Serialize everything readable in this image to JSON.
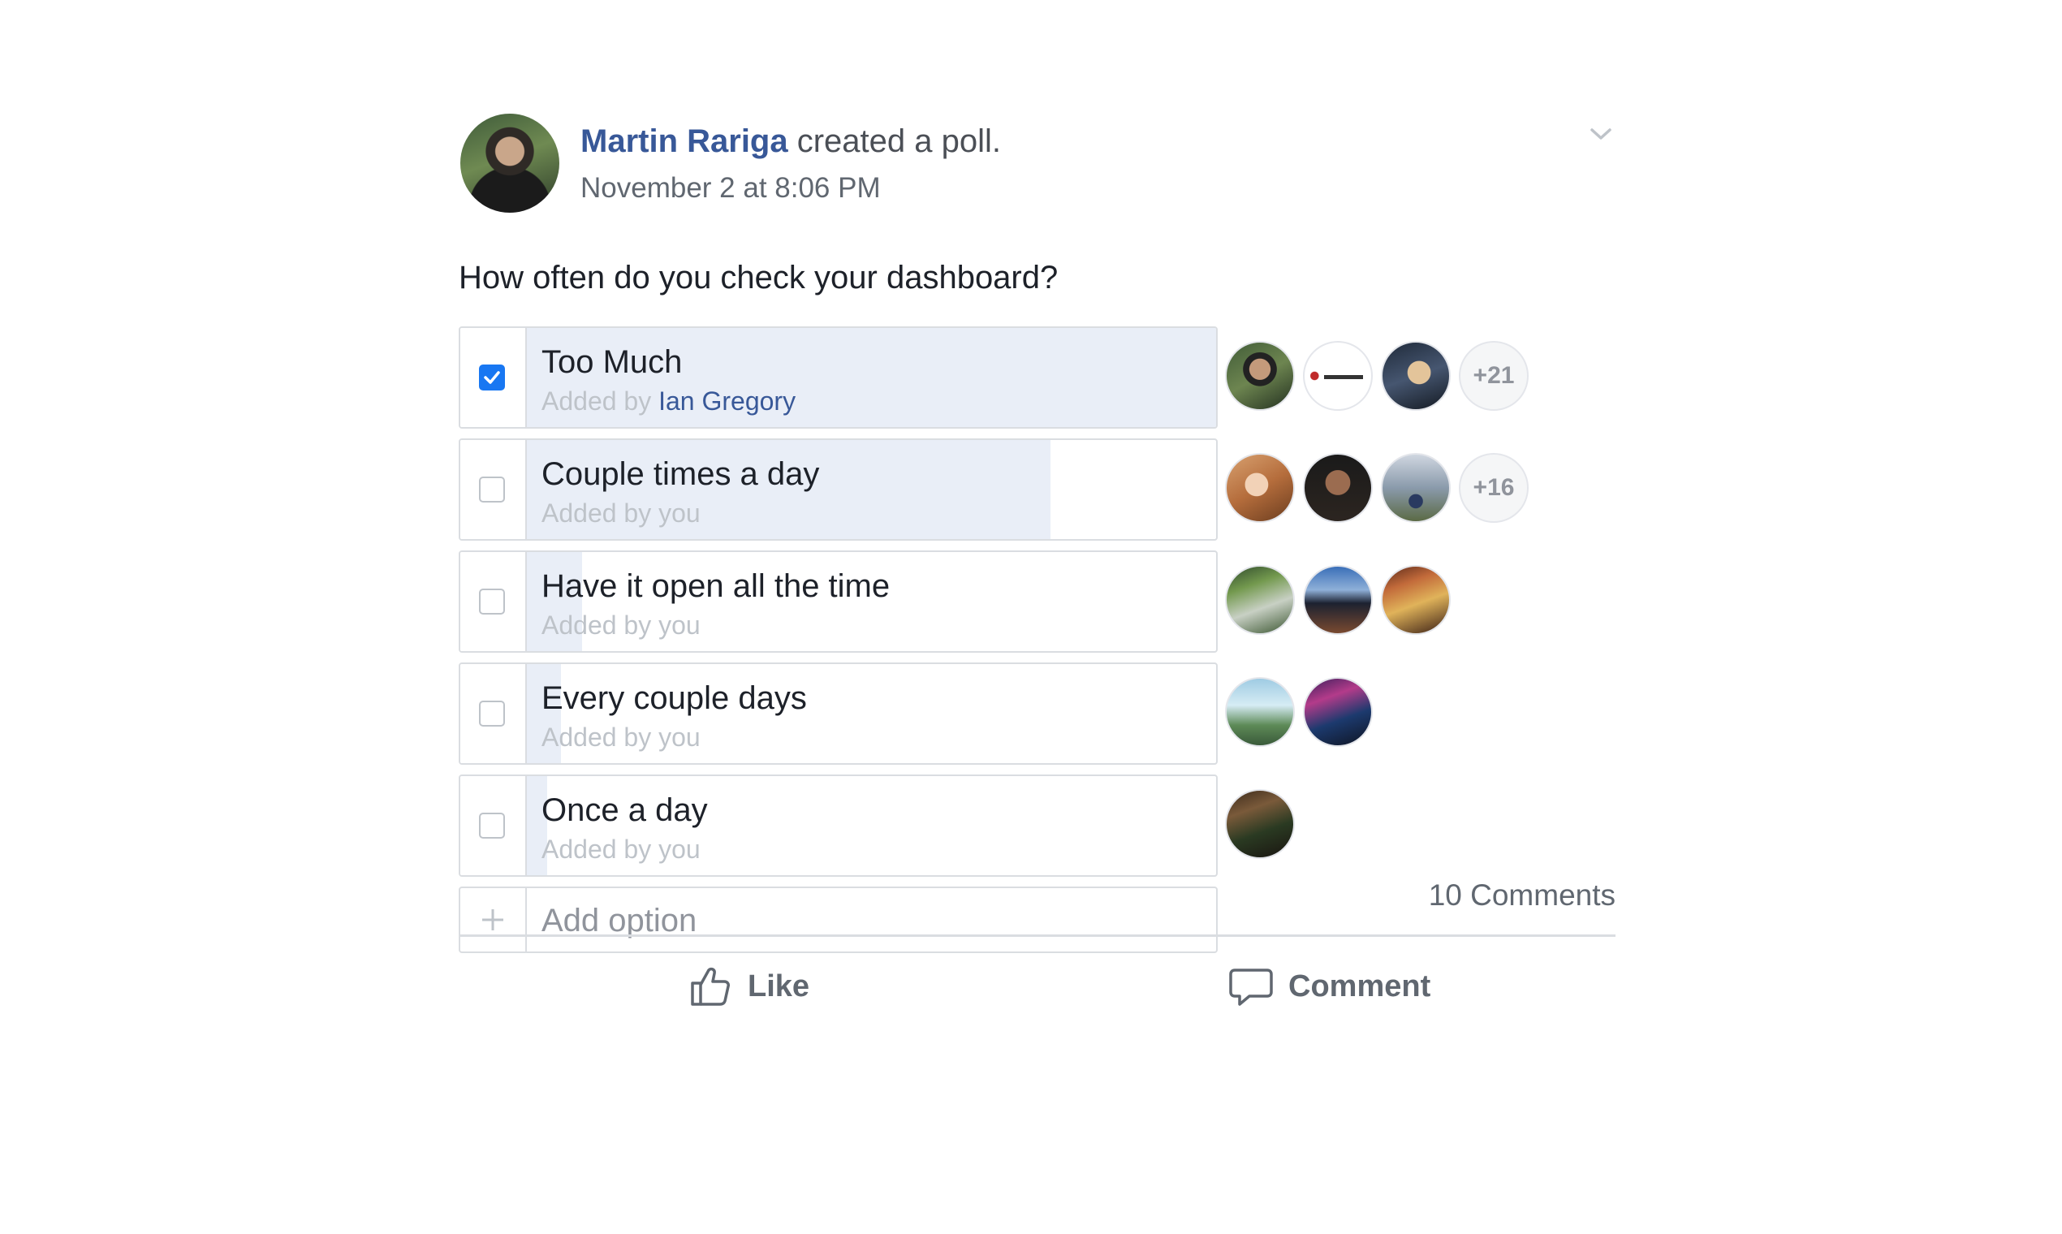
{
  "post": {
    "author": "Martin Rariga",
    "action_text": "created a poll.",
    "timestamp": "November 2 at 8:06 PM",
    "question": "How often do you check your dashboard?"
  },
  "poll": {
    "options": [
      {
        "label": "Too Much",
        "added_prefix": "Added by",
        "added_by": "Ian Gregory",
        "checked": true,
        "fill_fraction": 1.0,
        "voters_more": "+21"
      },
      {
        "label": "Couple times a day",
        "added_prefix": "Added by",
        "added_by": "you",
        "checked": false,
        "fill_fraction": 0.76,
        "voters_more": "+16"
      },
      {
        "label": "Have it open all the time",
        "added_prefix": "Added by",
        "added_by": "you",
        "checked": false,
        "fill_fraction": 0.08,
        "voters_more": ""
      },
      {
        "label": "Every couple days",
        "added_prefix": "Added by",
        "added_by": "you",
        "checked": false,
        "fill_fraction": 0.05,
        "voters_more": ""
      },
      {
        "label": "Once a day",
        "added_prefix": "Added by",
        "added_by": "you",
        "checked": false,
        "fill_fraction": 0.03,
        "voters_more": ""
      }
    ],
    "add_option_placeholder": "Add option"
  },
  "footer": {
    "comments": "10 Comments",
    "like_label": "Like",
    "comment_label": "Comment"
  },
  "colors": {
    "link": "#385898",
    "check": "#1877f2",
    "fill": "#e9eef7"
  },
  "icons": {
    "chevron": "chevron-down-icon",
    "like": "thumbs-up-icon",
    "comment": "comment-bubble-icon",
    "add": "plus-icon",
    "check": "checkmark-icon"
  }
}
